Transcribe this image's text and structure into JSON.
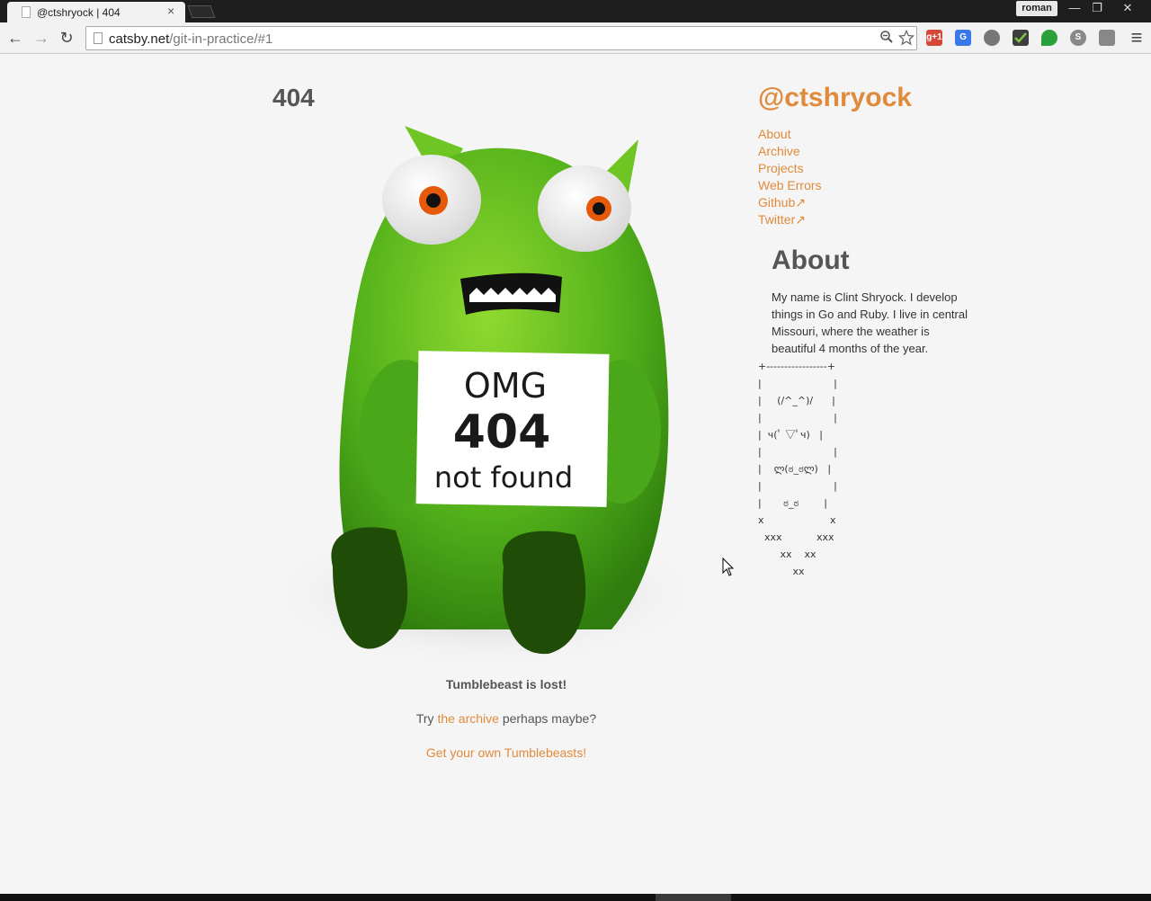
{
  "browser": {
    "tab_title": "@ctshryock | 404",
    "tab_close": "×",
    "user": "roman",
    "url_host": "catsby.net",
    "url_path": "/git-in-practice/#1",
    "win_min": "—",
    "win_restore": "❐",
    "win_close": "✕",
    "back": "←",
    "forward": "→",
    "reload": "↻",
    "menu": "≡",
    "ext_gplus": "g+1",
    "ext_translate": "G",
    "ext_skype": "S"
  },
  "page": {
    "heading": "404",
    "sign_line1": "OMG",
    "sign_line2": "404",
    "sign_line3": "not found",
    "lost_text": "Tumblebeast is lost!",
    "try_prefix": "Try ",
    "archive_link": "the archive",
    "try_suffix": " perhaps maybe?",
    "get_link": "Get your own Tumblebeasts!"
  },
  "sidebar": {
    "site_title": "@ctshryock",
    "nav": [
      "About",
      "Archive",
      "Projects",
      "Web Errors",
      "Github↗",
      "Twitter↗"
    ],
    "about_heading": "About",
    "about_text": "My name is Clint Shryock. I develop things in Go and Ruby. I live in central Missouri, where the weather is beautiful 4 months of the year.",
    "ascii": "+-----------------+\n|                       |\n|     (/^_^)/      |\n|                       |\n|  ч(ﾟ ▽ﾟч)   |\n|                       |\n|    ლ(ಠ_ಠლ)   |\n|                       |\n|       ಠ_ಠ        |\nx                     x\n  xxx           xxx\n       xx    xx\n           xx"
  },
  "colors": {
    "link": "#e08a3c",
    "beast_green": "#5cb81f",
    "background": "#f5f5f5"
  }
}
